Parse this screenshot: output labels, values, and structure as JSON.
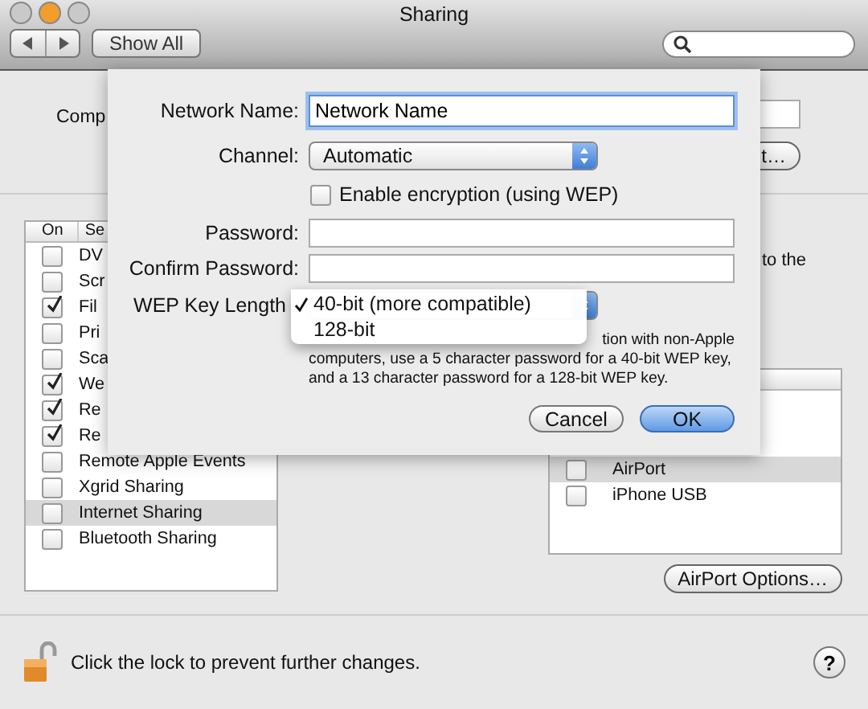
{
  "window": {
    "title": "Sharing"
  },
  "toolbar": {
    "show_all": "Show All"
  },
  "computer_name": {
    "label": "Comp",
    "button": "t…"
  },
  "services": {
    "columns": [
      "On",
      "Se"
    ],
    "items": [
      {
        "name": "DV",
        "on": false,
        "selected": false
      },
      {
        "name": "Scr",
        "on": false,
        "selected": false
      },
      {
        "name": "Fil",
        "on": true,
        "selected": false
      },
      {
        "name": "Pri",
        "on": false,
        "selected": false
      },
      {
        "name": "Sca",
        "on": false,
        "selected": false
      },
      {
        "name": "We",
        "on": true,
        "selected": false
      },
      {
        "name": "Re",
        "on": true,
        "selected": false
      },
      {
        "name": "Re",
        "on": true,
        "selected": false
      },
      {
        "name": "Remote Apple Events",
        "on": false,
        "selected": false
      },
      {
        "name": "Xgrid Sharing",
        "on": false,
        "selected": false
      },
      {
        "name": "Internet Sharing",
        "on": false,
        "selected": true
      },
      {
        "name": "Bluetooth Sharing",
        "on": false,
        "selected": false
      }
    ]
  },
  "right_panel": {
    "text": "to the",
    "ports": [
      {
        "name": "AirPort",
        "on": false,
        "selected": true
      },
      {
        "name": "iPhone USB",
        "on": false,
        "selected": false
      }
    ],
    "airport_options": "AirPort Options…"
  },
  "sheet": {
    "fields": [
      {
        "kind": "text",
        "label": "Network Name:",
        "value": "Network Name",
        "focused": true
      },
      {
        "kind": "popup",
        "label": "Channel:",
        "value": "Automatic"
      },
      {
        "kind": "checkbox",
        "label": "Enable encryption (using WEP)",
        "checked": false
      },
      {
        "kind": "password",
        "label": "Password:"
      },
      {
        "kind": "password",
        "label": "Confirm Password:"
      },
      {
        "kind": "menu",
        "label": "WEP Key Length",
        "options": [
          {
            "label": "40-bit (more compatible)",
            "selected": true
          },
          {
            "label": "128-bit",
            "selected": false
          }
        ]
      }
    ],
    "note": [
      "tion with non-Apple",
      "computers, use a 5 character password for a 40-bit WEP key,",
      "and a 13 character password for a 128-bit WEP key."
    ],
    "buttons": [
      {
        "label": "Cancel",
        "default": false
      },
      {
        "label": "OK",
        "default": true
      }
    ]
  },
  "footer": {
    "lock_text": "Click the lock to prevent further changes.",
    "help": "?"
  }
}
